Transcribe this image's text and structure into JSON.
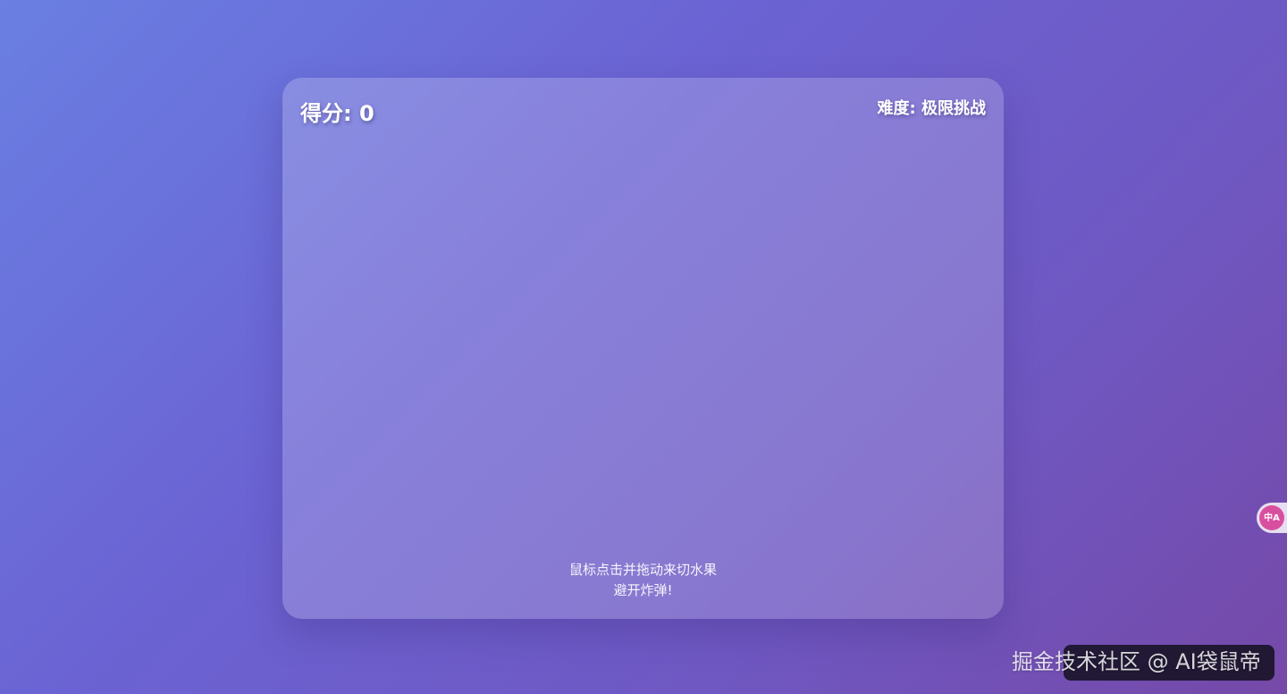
{
  "game": {
    "score_label": "得分: 0",
    "difficulty_label": "难度: 极限挑战",
    "instructions": {
      "line1": "鼠标点击并拖动来切水果",
      "line2": "避开炸弹!"
    }
  },
  "overlay": {
    "caption": "",
    "watermark": "掘金技术社区 @ AI袋鼠帝",
    "translate_icon": "translate-icon",
    "translate_text": "中A"
  },
  "colors": {
    "background_start": "#6a7fe2",
    "background_end": "#7549a8",
    "panel_overlay": "rgba(255,255,255,0.20)",
    "text": "#ffffff",
    "translate_accent": "#d94f9f"
  }
}
